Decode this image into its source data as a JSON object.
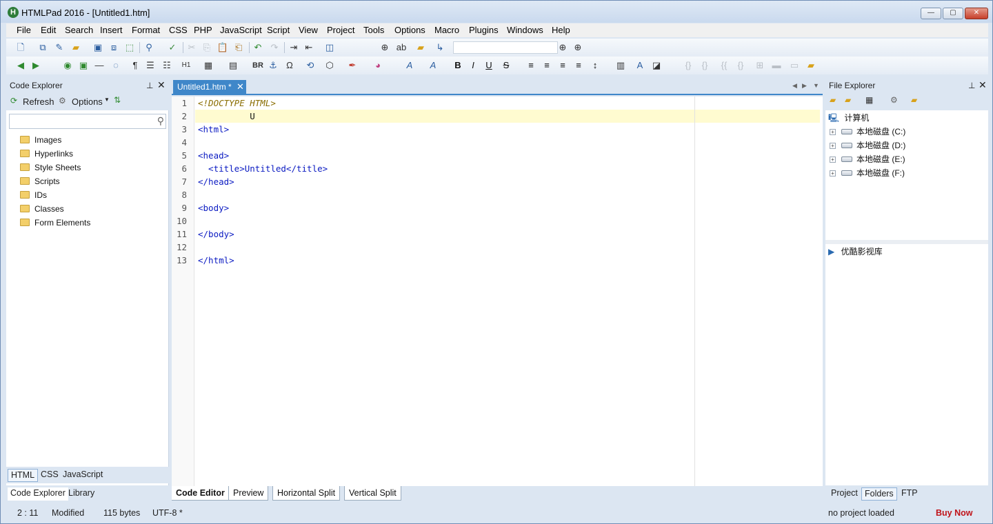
{
  "window": {
    "title": "HTMLPad 2016 - [Untitled1.htm]",
    "app_icon_letter": "H",
    "minimize": "—",
    "maximize": "▢",
    "close": "✕"
  },
  "menu": [
    "File",
    "Edit",
    "Search",
    "Insert",
    "Format",
    "CSS",
    "PHP",
    "JavaScript",
    "Script",
    "View",
    "Project",
    "Tools",
    "Options",
    "Macro",
    "Plugins",
    "Windows",
    "Help"
  ],
  "code_explorer": {
    "title": "Code Explorer",
    "refresh": "Refresh",
    "options": "Options",
    "search_placeholder": "",
    "tree": [
      "Images",
      "Hyperlinks",
      "Style Sheets",
      "Scripts",
      "IDs",
      "Classes",
      "Form Elements"
    ],
    "lang_tabs": [
      "HTML",
      "CSS",
      "JavaScript"
    ],
    "panel_tabs": [
      "Code Explorer",
      "Library"
    ]
  },
  "editor": {
    "tab_label": "Untitled1.htm *",
    "lines": [
      "<!DOCTYPE HTML>",
      "          U",
      "<html>",
      "",
      "<head>",
      "  <title>Untitled</title>",
      "</head>",
      "",
      "<body>",
      "",
      "</body>",
      "",
      "</html>"
    ],
    "view_tabs": [
      "Code Editor",
      "Preview",
      "Horizontal Split",
      "Vertical Split"
    ]
  },
  "file_explorer": {
    "title": "File Explorer",
    "root": "计算机",
    "drives": [
      "本地磁盘 (C:)",
      "本地磁盘 (D:)",
      "本地磁盘 (E:)",
      "本地磁盘 (F:)"
    ],
    "lower_item": "优酷影视库",
    "tabs": [
      "Project",
      "Folders",
      "FTP"
    ]
  },
  "status": {
    "position": "2 : 11",
    "state": "Modified",
    "size": "115 bytes",
    "encoding": "UTF-8 *",
    "project": "no project loaded",
    "buy": "Buy Now"
  },
  "colors": {
    "accent": "#3f87c9",
    "buy": "#c0141a",
    "tag": "#0a1ac2",
    "doctype": "#8a6d00"
  }
}
